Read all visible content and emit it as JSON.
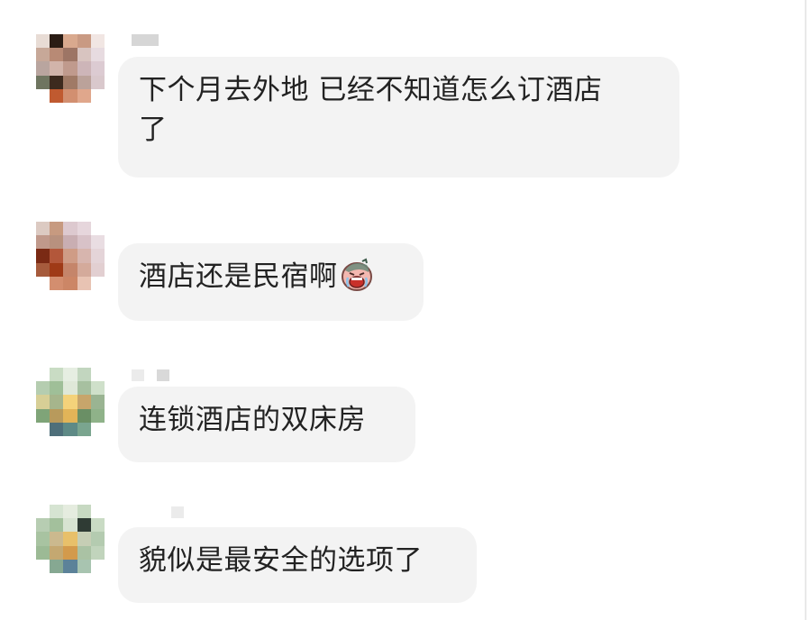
{
  "messages": [
    {
      "line1": "下个月去外地 已经不知道怎么订酒店",
      "line2": "了"
    },
    {
      "text": "酒店还是民宿啊",
      "emoji": "crying-face-emoji"
    },
    {
      "text": "连锁酒店的双床房"
    },
    {
      "text": "貌似是最安全的选项了"
    }
  ],
  "colors": {
    "bubble_bg": "#f3f3f3",
    "text": "#222222",
    "page_bg": "#ffffff"
  },
  "avatars": [
    "blurred-avatar-1",
    "blurred-avatar-2",
    "blurred-avatar-3",
    "blurred-avatar-4"
  ]
}
